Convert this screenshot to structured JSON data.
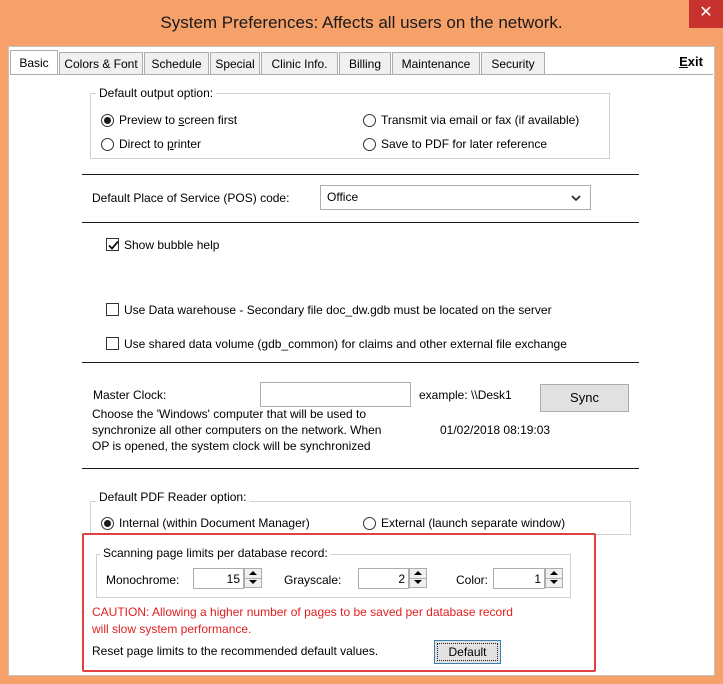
{
  "window": {
    "title": "System Preferences: Affects all users on the network.",
    "close_glyph": "✕"
  },
  "tabs": [
    {
      "label": "Basic",
      "active": true
    },
    {
      "label": "Colors & Font"
    },
    {
      "label": "Schedule"
    },
    {
      "label": "Special"
    },
    {
      "label": "Clinic Info."
    },
    {
      "label": "Billing"
    },
    {
      "label": "Maintenance"
    },
    {
      "label": "Security"
    }
  ],
  "exit": {
    "prefix": "E",
    "rest": "xit"
  },
  "output_option": {
    "legend": "Default output option:",
    "preview": {
      "pre": "Preview to ",
      "accel": "s",
      "post": "creen first",
      "selected": true
    },
    "direct": {
      "pre": "Direct to ",
      "accel": "p",
      "post": "rinter",
      "selected": false
    },
    "transmit": {
      "label": "Transmit via email or fax (if available)",
      "selected": false
    },
    "save_pdf": {
      "label": "Save to PDF for later reference",
      "selected": false
    }
  },
  "pos": {
    "label": "Default Place of Service (POS) code:",
    "value": "Office"
  },
  "bubble_help": {
    "label": "Show bubble help",
    "checked": true
  },
  "data_warehouse": {
    "label": "Use Data warehouse - Secondary file doc_dw.gdb must be located on the server",
    "checked": false
  },
  "shared_volume": {
    "label": "Use shared data volume (gdb_common) for claims and other external file exchange",
    "checked": false
  },
  "master_clock": {
    "label": "Master Clock:",
    "value": "",
    "example": "example:  \\\\Desk1",
    "sync_label": "Sync",
    "desc_line1": "Choose the 'Windows' computer that will be used to",
    "desc_line2": "synchronize all other computers on the network. When",
    "desc_line3": "OP is opened,  the system clock will be synchronized",
    "datetime": "01/02/2018 08:19:03"
  },
  "pdf_reader": {
    "legend": "Default PDF Reader option:",
    "internal": {
      "label": "Internal (within Document Manager)",
      "selected": true
    },
    "external": {
      "label": "External (launch separate window)",
      "selected": false
    }
  },
  "scanning": {
    "legend": "Scanning page limits per database record:",
    "mono_label": "Monochrome:",
    "mono_value": "15",
    "gray_label": "Grayscale:",
    "gray_value": "2",
    "color_label": "Color:",
    "color_value": "1",
    "caution_line1": "CAUTION: Allowing a higher number of pages to be saved per database record",
    "caution_line2": "will slow system performance.",
    "reset_label": "Reset page limits to the recommended default values.",
    "default_button": "Default"
  },
  "colors": {
    "title_bar": "#f6a06a",
    "close_button": "#c7322e",
    "caution_text": "#e02020",
    "highlight_border": "#e0403f"
  }
}
